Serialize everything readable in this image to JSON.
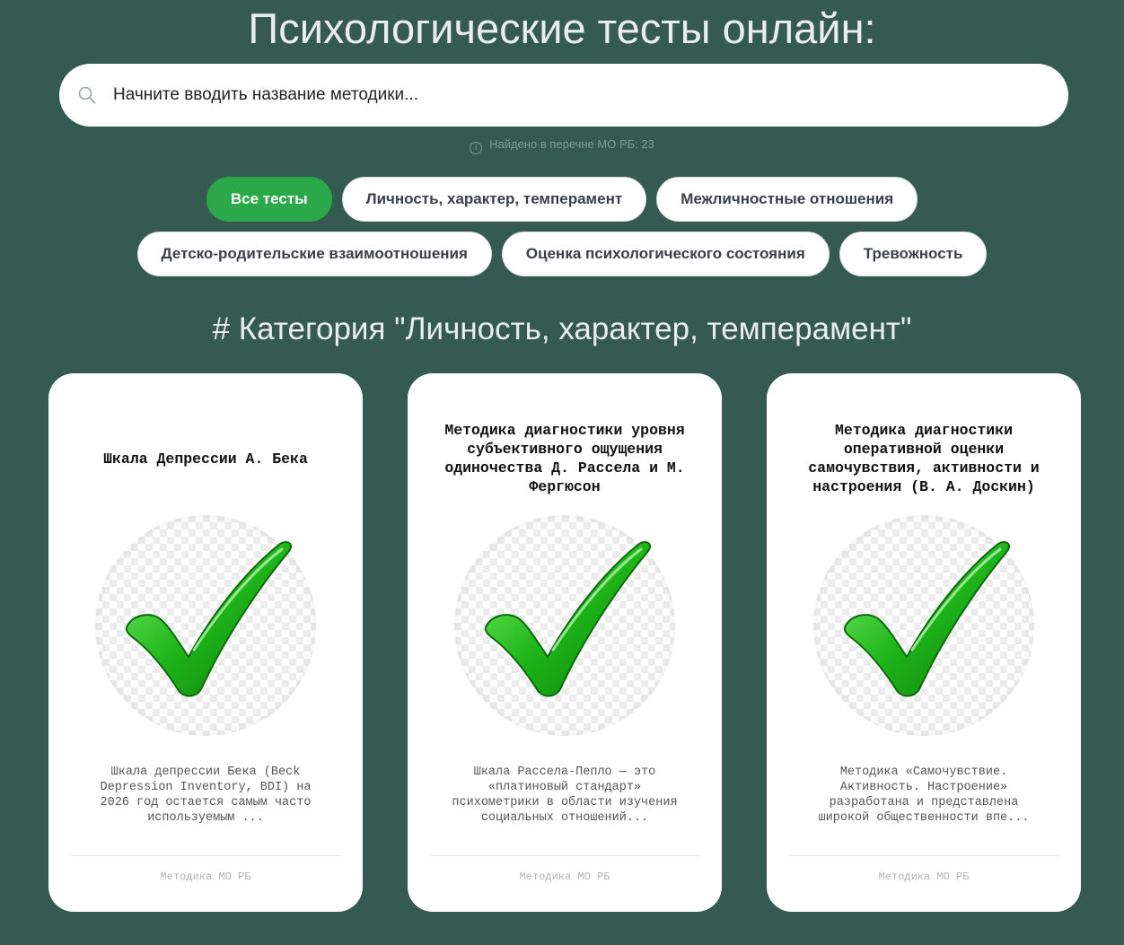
{
  "page": {
    "title": "Психологические тесты онлайн:"
  },
  "search": {
    "placeholder": "Начните вводить название методики...",
    "value": ""
  },
  "found_info": {
    "text": "Найдено в перечне МО РБ: 23"
  },
  "filters": [
    {
      "label": "Все тесты",
      "active": true
    },
    {
      "label": "Личность, характер, темперамент",
      "active": false
    },
    {
      "label": "Межличностные отношения",
      "active": false
    },
    {
      "label": "Детско-родительские взаимоотношения",
      "active": false
    },
    {
      "label": "Оценка психологического состояния",
      "active": false
    },
    {
      "label": "Тревожность",
      "active": false
    }
  ],
  "category": {
    "heading": "# Категория \"Личность, характер, темперамент\""
  },
  "cards": [
    {
      "title": "Шкала Депрессии А. Бека",
      "image_icon": "green-checkmark-icon",
      "description": "Шкала депрессии Бека (Beck Depression Inventory, BDI) на 2026 год остается самым часто используемым ...",
      "footer": "Методика МО РБ"
    },
    {
      "title": "Методика диагностики уровня субъективного ощущения одиночества Д. Рассела и М. Фергюсон",
      "image_icon": "green-checkmark-icon",
      "description": "Шкала Рассела-Пепло — это «платиновый стандарт» психометрики в области изучения социальных отношений...",
      "footer": "Методика МО РБ"
    },
    {
      "title": "Методика диагностики оперативной оценки самочувствия, активности и настроения (В. А. Доскин)",
      "image_icon": "green-checkmark-icon",
      "description": "Методика «Самочувствие. Активность. Настроение» разработана и представлена широкой общественности впе...",
      "footer": "Методика МО РБ"
    }
  ],
  "colors": {
    "background": "#345a52",
    "accent": "#2ba84a",
    "card": "#ffffff"
  }
}
